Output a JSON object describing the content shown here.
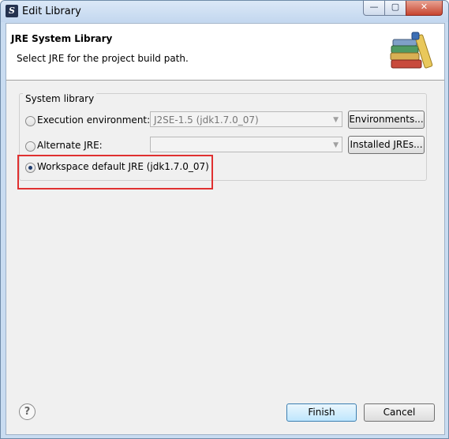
{
  "window": {
    "title": "Edit Library",
    "controls": {
      "minimize": "—",
      "maximize": "▢",
      "close": "✕"
    }
  },
  "header": {
    "title": "JRE System Library",
    "description": "Select JRE for the project build path."
  },
  "system_library": {
    "group_label": "System library",
    "execution_environment": {
      "label": "Execution environment:",
      "selected": false,
      "value": "J2SE-1.5 (jdk1.7.0_07)",
      "button": "Environments..."
    },
    "alternate_jre": {
      "label": "Alternate JRE:",
      "selected": false,
      "value": "",
      "button": "Installed JREs..."
    },
    "workspace_default": {
      "label": "Workspace default JRE (jdk1.7.0_07)",
      "selected": true
    }
  },
  "footer": {
    "help_icon": "?",
    "finish": "Finish",
    "cancel": "Cancel"
  },
  "colors": {
    "highlight": "#e03030",
    "title_bar": "#c9dcf1"
  }
}
